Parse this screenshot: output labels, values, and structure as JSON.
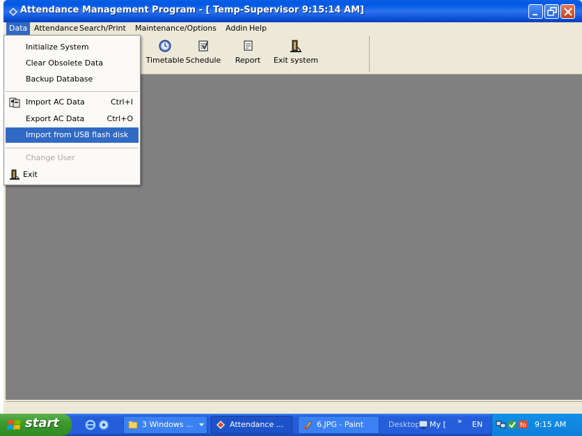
{
  "window": {
    "title": "Attendance Management Program - [ Temp-Supervisor 9:15:14 AM]"
  },
  "menubar": {
    "items": [
      "Data",
      "Attendance",
      "Search/Print",
      "Maintenance/Options",
      "Addin",
      "Help"
    ]
  },
  "toolbar": {
    "buttons": [
      {
        "label": "Timetable",
        "icon": "clock-icon"
      },
      {
        "label": "Schedule",
        "icon": "schedule-icon"
      },
      {
        "label": "Report",
        "icon": "report-icon"
      },
      {
        "label": "Exit system",
        "icon": "exit-icon"
      }
    ]
  },
  "data_menu": {
    "items": [
      {
        "label": "Initialize System"
      },
      {
        "label": "Clear Obsolete Data"
      },
      {
        "label": "Backup Database"
      },
      {
        "label": "Import AC Data",
        "shortcut": "Ctrl+I",
        "icon": "import-icon"
      },
      {
        "label": "Export AC Data",
        "shortcut": "Ctrl+O"
      },
      {
        "label": "Import from USB flash disk",
        "state": "highlighted"
      },
      {
        "label": "Change User",
        "state": "disabled"
      },
      {
        "label": "Exit",
        "icon": "exit-icon"
      }
    ]
  },
  "taskbar": {
    "start_label": "start",
    "tasks": [
      {
        "label": "3 Windows ...",
        "icon": "folder-icon"
      },
      {
        "label": "Attendance ...",
        "icon": "app-icon",
        "active": true
      },
      {
        "label": "6.JPG - Paint",
        "icon": "paint-icon"
      }
    ],
    "desktop_label": "Desktop",
    "my_label": "My [",
    "chevron": "»",
    "lang": "EN",
    "clock": "9:15 AM"
  },
  "colors": {
    "titlebar": "#0058e6",
    "menu_highlight": "#316ac5",
    "client_bg": "#808080",
    "taskbar": "#245edb",
    "start_button": "#3c9a2e"
  }
}
